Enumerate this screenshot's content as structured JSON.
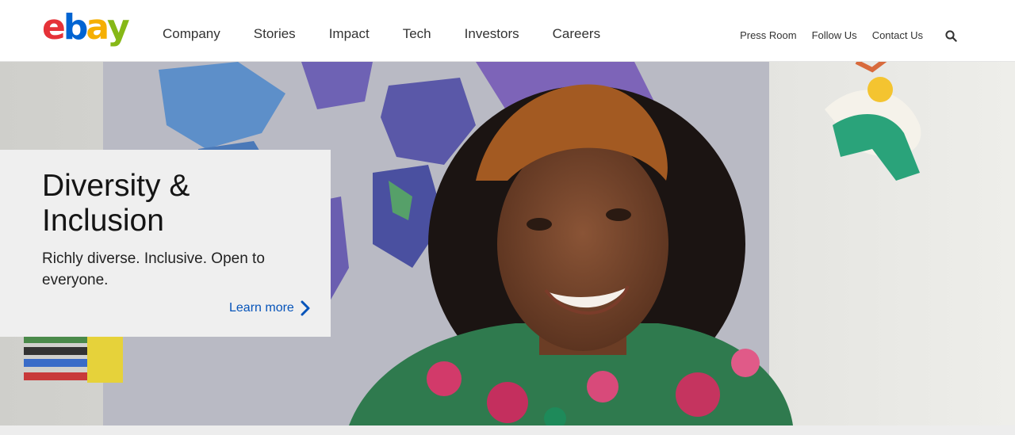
{
  "brand": {
    "logo_letters": [
      "e",
      "b",
      "a",
      "y"
    ],
    "logo_colors": [
      "#e53238",
      "#0064d2",
      "#f5af02",
      "#86b817"
    ]
  },
  "nav": {
    "main": [
      "Company",
      "Stories",
      "Impact",
      "Tech",
      "Investors",
      "Careers"
    ],
    "utility": [
      "Press Room",
      "Follow Us",
      "Contact Us"
    ]
  },
  "icons": {
    "search": "search-icon",
    "learn_more_arrow": "chevron-right-icon"
  },
  "hero": {
    "title": "Diversity & Inclusion",
    "subtitle": "Richly diverse. Inclusive. Open to everyone.",
    "link_label": "Learn more"
  },
  "colors": {
    "link": "#0654ba",
    "card_bg": "#efefef"
  }
}
